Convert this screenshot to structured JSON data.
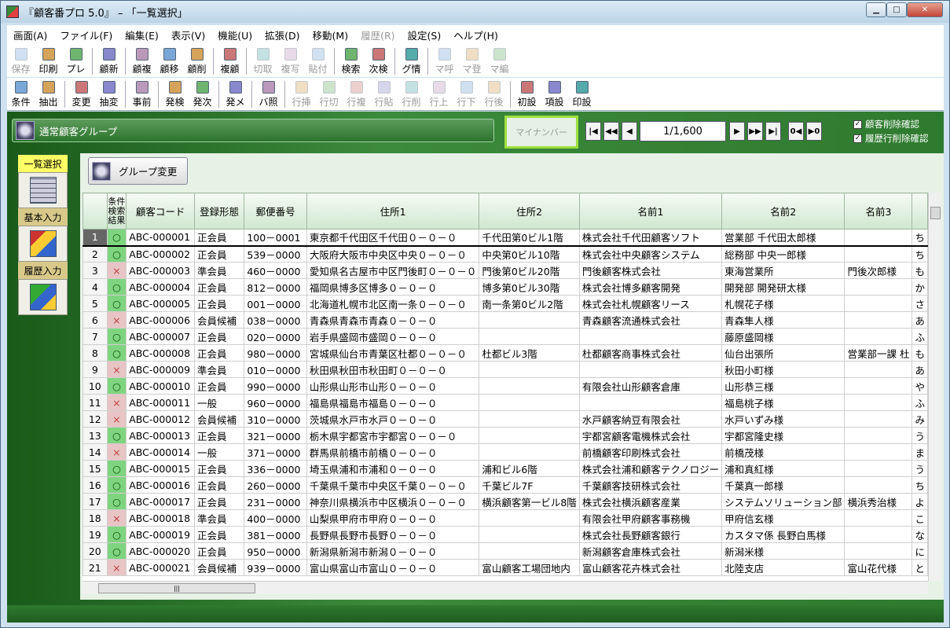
{
  "window": {
    "title": "『顧客番プロ 5.0』 – 「一覧選択」"
  },
  "menu": [
    "画面(A)",
    "ファイル(F)",
    "編集(E)",
    "表示(V)",
    "機能(U)",
    "拡張(D)",
    "移動(M)",
    "履歴(R)",
    "設定(S)",
    "ヘルプ(H)"
  ],
  "menu_disabled": [
    7
  ],
  "toolbar1": [
    {
      "label": "保存",
      "dis": true
    },
    {
      "label": "印刷"
    },
    {
      "label": "プレ"
    },
    {
      "sep": true
    },
    {
      "label": "顧新"
    },
    {
      "sep": true
    },
    {
      "label": "顧複"
    },
    {
      "label": "顧移"
    },
    {
      "label": "顧削"
    },
    {
      "sep": true
    },
    {
      "label": "複顧"
    },
    {
      "sep": true
    },
    {
      "label": "切取",
      "dis": true
    },
    {
      "label": "複写",
      "dis": true
    },
    {
      "label": "貼付",
      "dis": true
    },
    {
      "sep": true
    },
    {
      "label": "検索"
    },
    {
      "label": "次検"
    },
    {
      "sep": true
    },
    {
      "label": "グ情"
    },
    {
      "sep": true
    },
    {
      "label": "マ呼",
      "dis": true
    },
    {
      "label": "マ登",
      "dis": true
    },
    {
      "label": "マ編",
      "dis": true
    }
  ],
  "toolbar2": [
    {
      "label": "条件"
    },
    {
      "label": "抽出"
    },
    {
      "sep": true
    },
    {
      "label": "変更"
    },
    {
      "label": "抽変"
    },
    {
      "sep": true
    },
    {
      "label": "事前"
    },
    {
      "sep": true
    },
    {
      "label": "発検"
    },
    {
      "label": "発次"
    },
    {
      "sep": true
    },
    {
      "label": "発メ"
    },
    {
      "sep": true
    },
    {
      "label": "バ照"
    },
    {
      "sep": true
    },
    {
      "label": "行挿",
      "dis": true
    },
    {
      "label": "行切",
      "dis": true
    },
    {
      "label": "行複",
      "dis": true
    },
    {
      "label": "行貼",
      "dis": true
    },
    {
      "label": "行削",
      "dis": true
    },
    {
      "label": "行上",
      "dis": true
    },
    {
      "label": "行下",
      "dis": true
    },
    {
      "label": "行後",
      "dis": true
    },
    {
      "sep": true
    },
    {
      "label": "初設"
    },
    {
      "label": "項設"
    },
    {
      "label": "印設"
    }
  ],
  "group": {
    "name": "通常顧客グループ",
    "mynumber": "マイナンバー",
    "change_button": "グループ変更"
  },
  "nav": {
    "page": "1/1,600"
  },
  "checks": {
    "delete_confirm": "顧客削除確認",
    "history_delete_confirm": "履歴行削除確認"
  },
  "leftpane": {
    "tab1": "一覧選択",
    "tab2": "基本入力",
    "tab3": "履歴入力"
  },
  "grid": {
    "headers": [
      "",
      "条件\n検索\n結果",
      "顧客コード",
      "登録形態",
      "郵便番号",
      "住所1",
      "住所2",
      "名前1",
      "名前2",
      "名前3",
      ""
    ],
    "rows": [
      [
        "1",
        "○",
        "ABC-000001",
        "正会員",
        "100－0001",
        "東京都千代田区千代田０－０－０",
        "千代田第0ビル1階",
        "株式会社千代田顧客ソフト",
        "営業部 千代田太郎様",
        "",
        "ち"
      ],
      [
        "2",
        "○",
        "ABC-000002",
        "正会員",
        "539－0000",
        "大阪府大阪市中央区中央０－０－０",
        "中央第0ビル10階",
        "株式会社中央顧客システム",
        "総務部 中央一郎様",
        "",
        "ち"
      ],
      [
        "3",
        "×",
        "ABC-000003",
        "準会員",
        "460－0000",
        "愛知県名古屋市中区門後町０－０－０",
        "門後第0ビル20階",
        "門後顧客株式会社",
        "東海営業所",
        "門後次郎様",
        "も"
      ],
      [
        "4",
        "○",
        "ABC-000004",
        "正会員",
        "812－0000",
        "福岡県博多区博多０－０－０",
        "博多第0ビル30階",
        "株式会社博多顧客開発",
        "開発部 開発研太様",
        "",
        "か"
      ],
      [
        "5",
        "○",
        "ABC-000005",
        "正会員",
        "001－0000",
        "北海道札幌市北区南一条０－０－０",
        "南一条第0ビル2階",
        "株式会社札幌顧客リース",
        "札幌花子様",
        "",
        "さ"
      ],
      [
        "6",
        "×",
        "ABC-000006",
        "会員候補",
        "038－0000",
        "青森県青森市青森０－０－０",
        "",
        "青森顧客流通株式会社",
        "青森隼人様",
        "",
        "あ"
      ],
      [
        "7",
        "○",
        "ABC-000007",
        "正会員",
        "020－0000",
        "岩手県盛岡市盛岡０－０－０",
        "",
        "",
        "藤原盛岡様",
        "",
        "ふ"
      ],
      [
        "8",
        "○",
        "ABC-000008",
        "正会員",
        "980－0000",
        "宮城県仙台市青葉区杜都０－０－０",
        "杜都ビル3階",
        "杜都顧客商事株式会社",
        "仙台出張所",
        "営業部一課 杜",
        "も"
      ],
      [
        "9",
        "×",
        "ABC-000009",
        "準会員",
        "010－0000",
        "秋田県秋田市秋田町０－０－０",
        "",
        "",
        "秋田小町様",
        "",
        "あ"
      ],
      [
        "10",
        "○",
        "ABC-000010",
        "正会員",
        "990－0000",
        "山形県山形市山形０－０－０",
        "",
        "有限会社山形顧客倉庫",
        "山形恭三様",
        "",
        "や"
      ],
      [
        "11",
        "×",
        "ABC-000011",
        "一般",
        "960－0000",
        "福島県福島市福島０－０－０",
        "",
        "",
        "福島桃子様",
        "",
        "ふ"
      ],
      [
        "12",
        "×",
        "ABC-000012",
        "会員候補",
        "310－0000",
        "茨城県水戸市水戸０－０－０",
        "",
        "水戸顧客納豆有限会社",
        "水戸いずみ様",
        "",
        "み"
      ],
      [
        "13",
        "○",
        "ABC-000013",
        "正会員",
        "321－0000",
        "栃木県宇都宮市宇都宮０－０－０",
        "",
        "宇都宮顧客電機株式会社",
        "宇都宮隆史様",
        "",
        "う"
      ],
      [
        "14",
        "×",
        "ABC-000014",
        "一般",
        "371－0000",
        "群馬県前橋市前橋０－０－０",
        "",
        "前橋顧客印刷株式会社",
        "前橋茂様",
        "",
        "ま"
      ],
      [
        "15",
        "○",
        "ABC-000015",
        "正会員",
        "336－0000",
        "埼玉県浦和市浦和０－０－０",
        "浦和ビル6階",
        "株式会社浦和顧客テクノロジー",
        "浦和真紅様",
        "",
        "う"
      ],
      [
        "16",
        "○",
        "ABC-000016",
        "正会員",
        "260－0000",
        "千葉県千葉市中央区千葉０－０－０",
        "千葉ビル7F",
        "千葉顧客技研株式会社",
        "千葉真一郎様",
        "",
        "ち"
      ],
      [
        "17",
        "○",
        "ABC-000017",
        "正会員",
        "231－0000",
        "神奈川県横浜市中区横浜０－０－０",
        "横浜顧客第一ビル8階",
        "株式会社横浜顧客産業",
        "システムソリューション部",
        "横浜秀治様",
        "よ"
      ],
      [
        "18",
        "×",
        "ABC-000018",
        "準会員",
        "400－0000",
        "山梨県甲府市甲府０－０－０",
        "",
        "有限会社甲府顧客事務機",
        "甲府信玄様",
        "",
        "こ"
      ],
      [
        "19",
        "○",
        "ABC-000019",
        "正会員",
        "381－0000",
        "長野県長野市長野０－０－０",
        "",
        "株式会社長野顧客銀行",
        "カスタマ係 長野白馬様",
        "",
        "な"
      ],
      [
        "20",
        "○",
        "ABC-000020",
        "正会員",
        "950－0000",
        "新潟県新潟市新潟０－０－０",
        "",
        "新潟顧客倉庫株式会社",
        "新潟米様",
        "",
        "に"
      ],
      [
        "21",
        "×",
        "ABC-000021",
        "会員候補",
        "939－0000",
        "富山県富山市富山０－０－０",
        "富山顧客工場団地内",
        "富山顧客花卉株式会社",
        "北陸支店",
        "富山花代様",
        "と"
      ]
    ]
  }
}
